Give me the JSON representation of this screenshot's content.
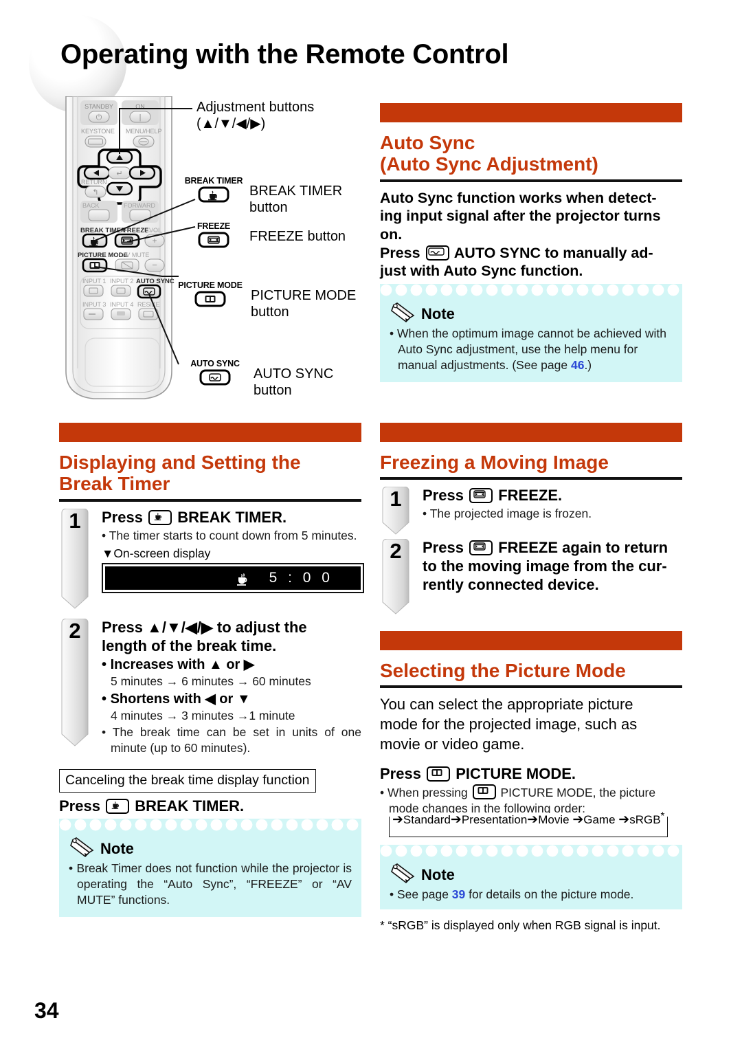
{
  "page": {
    "title": "Operating with the Remote Control",
    "number": "34"
  },
  "remote_diagram": {
    "buttons": {
      "standby": "STANDBY",
      "on": "ON",
      "keystone": "KEYSTONE",
      "menu_help": "MENU/HELP",
      "enter": "ENTER",
      "return": "RETURN",
      "back": "BACK",
      "forward": "FORWARD",
      "break_timer": "BREAK TIMER",
      "freeze": "FREEZE",
      "vol": "VOL",
      "picture_mode": "PICTURE MODE",
      "av_mute": "AV MUTE",
      "input1": "INPUT 1",
      "input2": "INPUT 2",
      "auto_sync": "AUTO SYNC",
      "input3": "INPUT 3",
      "input4": "INPUT 4",
      "resize": "RESIZE"
    },
    "callouts": [
      {
        "key_label": "",
        "text_line1": "Adjustment buttons",
        "text_line2": "(▲/▼/◀/▶)"
      },
      {
        "key_label": "BREAK TIMER",
        "text_line1": "BREAK TIMER",
        "text_line2": "button"
      },
      {
        "key_label": "FREEZE",
        "text_line1": "FREEZE button",
        "text_line2": ""
      },
      {
        "key_label": "PICTURE MODE",
        "text_line1": "PICTURE MODE",
        "text_line2": "button"
      },
      {
        "key_label": "AUTO SYNC",
        "text_line1": "AUTO SYNC",
        "text_line2": "button"
      }
    ]
  },
  "auto_sync_section": {
    "heading_line1": "Auto Sync",
    "heading_line2": "(Auto Sync Adjustment)",
    "body_line1": "Auto Sync function works when detect-",
    "body_line2": "ing input signal after the projector turns",
    "body_line3": "on.",
    "body_press_prefix": "Press",
    "body_press_suffix": "AUTO SYNC to manually ad-",
    "body_line5": "just with Auto Sync function.",
    "note": {
      "label": "Note",
      "items": [
        {
          "text_before": "When the optimum image cannot be achieved with Auto Sync adjustment, use the help menu for manual adjustments. (See page ",
          "page_ref": "46",
          "text_after": ".)"
        }
      ]
    }
  },
  "break_timer_section": {
    "heading_line1": "Displaying and Setting the",
    "heading_line2": "Break Timer",
    "steps": [
      {
        "num": "1",
        "head_prefix": "Press",
        "head_suffix": "BREAK TIMER.",
        "bullets": [
          "The timer starts to count down from 5 minutes."
        ],
        "osd_caption": "▼On-screen display",
        "osd_time": "5 : 0 0"
      },
      {
        "num": "2",
        "head_line1": "Press ▲/▼/◀/▶ to adjust the",
        "head_line2": "length of the break time.",
        "bullets_bold": [
          {
            "label": "Increases with ▲ or ▶",
            "detail": "5 minutes → 6 minutes → 60 minutes"
          },
          {
            "label": "Shortens with ◀ or ▼",
            "detail": "4 minutes → 3 minutes →1 minute"
          }
        ],
        "bullets": [
          "The break time can be set in units of one minute (up to 60 minutes)."
        ]
      }
    ],
    "cancel_box_label": "Canceling the break time display function",
    "cancel_press_prefix": "Press",
    "cancel_press_suffix": "BREAK TIMER.",
    "note": {
      "label": "Note",
      "items": [
        {
          "text_before": "Break Timer does not function while the projector is operating the “Auto Sync”, “FREEZE” or “AV MUTE” functions.",
          "page_ref": "",
          "text_after": ""
        }
      ]
    }
  },
  "freeze_section": {
    "heading": "Freezing a Moving Image",
    "steps": [
      {
        "num": "1",
        "head_prefix": "Press",
        "head_suffix": "FREEZE.",
        "bullets": [
          "The projected image is frozen."
        ]
      },
      {
        "num": "2",
        "head_prefix": "Press",
        "head_suffix": "FREEZE again to return",
        "head_line2": "to the moving image from the cur-",
        "head_line3": "rently connected device."
      }
    ]
  },
  "picture_mode_section": {
    "heading": "Selecting the Picture Mode",
    "body_line1": "You can select the appropriate picture",
    "body_line2": "mode for the projected image, such as",
    "body_line3": "movie or video game.",
    "press_prefix": "Press",
    "press_suffix": "PICTURE MODE.",
    "bullet_prefix": "When pressing",
    "bullet_suffix": "PICTURE MODE, the picture",
    "bullet_line2": "mode changes in the following order:",
    "mode_chain": [
      "Standard",
      "Presentation",
      "Movie",
      "Game",
      "sRGB"
    ],
    "chain_star": "*",
    "note": {
      "label": "Note",
      "items": [
        {
          "text_before": "See page ",
          "page_ref": "39",
          "text_after": " for details on the picture mode."
        }
      ]
    },
    "footnote": "* “sRGB” is displayed only when RGB signal is input."
  },
  "colors": {
    "accent_orange": "#c4380a",
    "note_cyan": "#d2f6f6",
    "page_ref_blue": "#2b49d6"
  }
}
